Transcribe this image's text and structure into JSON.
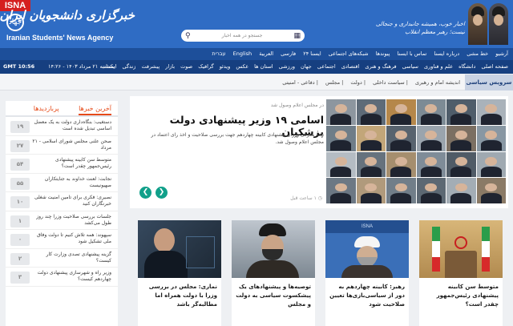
{
  "header": {
    "badge": "ISNA",
    "brand_fa": "خبرگزاری دانشجویان ایران، ایسنا",
    "brand_en": "Iranian Students' News Agency",
    "emblem": "جهاد",
    "search_placeholder": "جستجو در همه اخبار",
    "slogan": "اخبار خوب، همیشه جانبداری و جنجالی نیست؛ رهبر معظم انقلاب"
  },
  "nav_top": [
    "آرشیو",
    "خط مشی",
    "درباره ایسنا",
    "تماس با ایسنا",
    "پیوندها",
    "شبکه‌های اجتماعی",
    "ایسنا ۲۴",
    "فارسی",
    "العربیة",
    "English",
    "עברית"
  ],
  "nav_main": [
    "صفحه اصلی",
    "دانشگاه",
    "علم و فناوری",
    "سیاسی",
    "فرهنگ و هنری",
    "اقتصادی",
    "اجتماعی",
    "جهان",
    "ورزشی",
    "استان ها",
    "عکس",
    "ویدئو",
    "گرافیک",
    "صوت",
    "بازار",
    "پیشرفت",
    "زندگی",
    "ایسنات"
  ],
  "date_fa": "یکشنبه ۲۱ مرداد ۱۴۰۳ - ۱۴:۲۶",
  "gmt": "GMT 10:56",
  "section": {
    "label": "سرویس سیاسی",
    "tabs": [
      "اندیشه امام و رهبری",
      "سیاست داخلی",
      "دولت",
      "مجلس",
      "دفاعی - امنیتی"
    ]
  },
  "sidebar": {
    "tab_latest": "آخرین خبرها",
    "tab_popular": "پربازدیدها",
    "items": [
      {
        "title": "دستغیب: بنگاه‌داری دولت به یک معضل اساسی تبدیل شده است",
        "count": "۱۹"
      },
      {
        "title": "صحن علنی مجلس شورای اسلامی - ۲۱ مرداد",
        "count": "۲۷"
      },
      {
        "title": "متوسط سن کابینه پیشنهادی رئیس‌جمهور چقدر است؟",
        "count": "۵۴"
      },
      {
        "title": "نجابت: لعنت خداوند به جنایتکاران صهیونیست",
        "count": "۵۵"
      },
      {
        "title": "نصیری: فکری برای تامین امنیت شغلی خبرنگاران کنید",
        "count": "۱۰"
      },
      {
        "title": "جلسات بررسی صلاحیت وزرا چند روز طول می‌کشد",
        "count": "۱"
      },
      {
        "title": "سپهوند: همه تلاش کنیم تا دولت وفاق ملی تشکیل شود",
        "count": "۰"
      },
      {
        "title": "گزینه پیشنهادی تصدی وزارت کار کیست؟",
        "count": "۲"
      },
      {
        "title": "وزیر راه و شهرسازی پیشنهادی دولت چهاردهم کیست؟",
        "count": "۳"
      }
    ]
  },
  "hero": {
    "sub": "در مجلس اعلام وصول شد",
    "title": "اسامی ۱۹ وزیر پیشنهادی دولت پزشکیان",
    "lead": "نامه معرفی وزرای پیشنهادی کابینه چهاردهم جهت بررسی صلاحیت و اخذ رای اعتماد در مجلس اعلام وصول شد.",
    "time": "۱ ساعت قبل"
  },
  "cards": [
    {
      "title": "متوسط سن کابینه پیشنهادی رئیس‌جمهور چقدر است؟"
    },
    {
      "title": "رهبر: کابینه چهاردهم به دور از سیاسی‌بازی‌ها تعیین صلاحیت شود"
    },
    {
      "title": "توصیه‌ها و پیشنهادهای یک پیشکسوت سیاسی به دولت و مجلس"
    },
    {
      "title": "نماری: مجلس در بررسی وزرا با دولت همراه اما مطالبه‌گر باشد"
    }
  ],
  "colors": {
    "header_blue": "#2f6cc4",
    "nav_dark": "#163f80",
    "accent_orange": "#e64a19",
    "arrow_teal": "#11a08a",
    "isna_red": "#d51f1f"
  }
}
